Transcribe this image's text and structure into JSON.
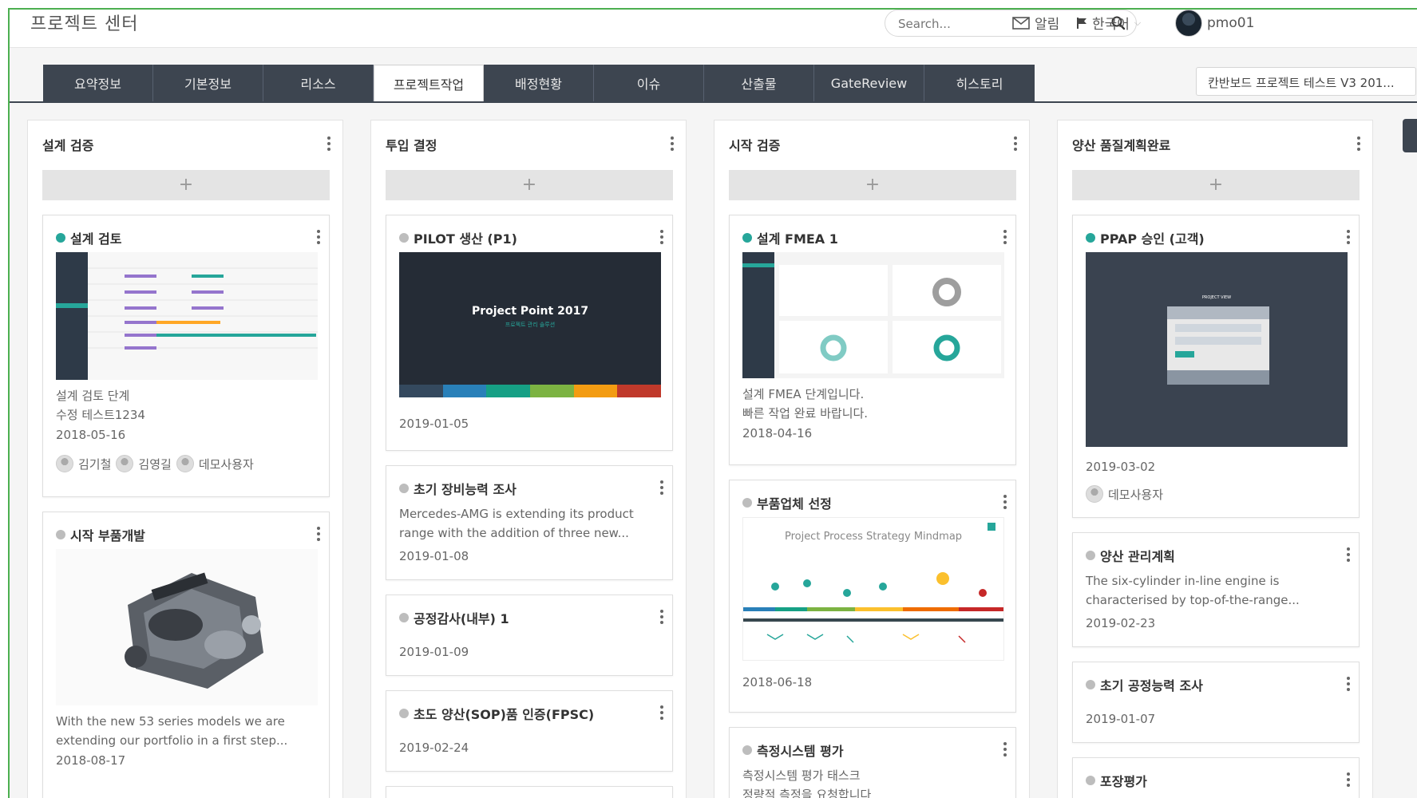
{
  "header": {
    "app_title": "프로젝트 센터",
    "search_placeholder": "Search...",
    "alerts_label": "알림",
    "language_label": "한국어",
    "username": "pmo01"
  },
  "tabs": [
    {
      "label": "요약정보",
      "active": false
    },
    {
      "label": "기본정보",
      "active": false
    },
    {
      "label": "리소스",
      "active": false
    },
    {
      "label": "프로젝트작업",
      "active": true
    },
    {
      "label": "배정현황",
      "active": false
    },
    {
      "label": "이슈",
      "active": false
    },
    {
      "label": "산출물",
      "active": false
    },
    {
      "label": "GateReview",
      "active": false
    },
    {
      "label": "히스토리",
      "active": false
    }
  ],
  "project_select": "칸반보드 프로젝트 테스트 V3 201...",
  "add_symbol": "+",
  "columns": [
    {
      "title": "설계 검증",
      "cards": [
        {
          "title": "설계 검토",
          "status": "teal",
          "text_lines": [
            "설계 검토 단계",
            "수정 테스트1234"
          ],
          "date": "2018-05-16",
          "users": [
            "김기철",
            "김영길",
            "데모사용자"
          ]
        },
        {
          "title": "시작 부품개발",
          "status": "gray",
          "text_lines": [
            "With the new 53 series models we are",
            "extending our portfolio in a first step..."
          ],
          "date": "2018-08-17"
        }
      ]
    },
    {
      "title": "투입 결정",
      "cards": [
        {
          "title": "PILOT 생산 (P1)",
          "status": "gray",
          "thumb_title": "Project Point 2017",
          "thumb_sub": "프로젝트 관리 솔루션",
          "date": "2019-01-05"
        },
        {
          "title": "초기 장비능력 조사",
          "status": "gray",
          "text_lines": [
            "Mercedes-AMG is extending its product",
            "range with the addition of three new..."
          ],
          "date": "2019-01-08"
        },
        {
          "title": "공정감사(내부) 1",
          "status": "gray",
          "date": "2019-01-09"
        },
        {
          "title": "초도 양산(SOP)품 인증(FPSC)",
          "status": "gray",
          "date": "2019-02-24"
        }
      ]
    },
    {
      "title": "시작 검증",
      "cards": [
        {
          "title": "설계 FMEA 1",
          "status": "teal",
          "text_lines": [
            "설계 FMEA 단계입니다.",
            "빠른 작업 완료 바랍니다."
          ],
          "date": "2018-04-16"
        },
        {
          "title": "부품업체 선정",
          "status": "gray",
          "thumb_title": "Project Process Strategy Mindmap",
          "date": "2018-06-18"
        },
        {
          "title": "측정시스템 평가",
          "status": "gray",
          "text_lines": [
            "측정시스템 평가 태스크",
            "정량적 측정을 요청합니다"
          ]
        }
      ]
    },
    {
      "title": "양산 품질계획완료",
      "cards": [
        {
          "title": "PPAP 승인 (고객)",
          "status": "teal",
          "thumb_title": "PROJECT VIEW",
          "date": "2019-03-02",
          "users": [
            "데모사용자"
          ]
        },
        {
          "title": "양산 관리계획",
          "status": "gray",
          "text_lines": [
            "The six-cylinder in-line engine is",
            "characterised by top-of-the-range..."
          ],
          "date": "2019-02-23"
        },
        {
          "title": "초기 공정능력 조사",
          "status": "gray",
          "date": "2019-01-07"
        },
        {
          "title": "포장평가",
          "status": "gray"
        }
      ]
    }
  ],
  "colors": {
    "tab_bar": "#3d4550",
    "teal": "#26a69a",
    "frame_border": "#4caf50"
  }
}
